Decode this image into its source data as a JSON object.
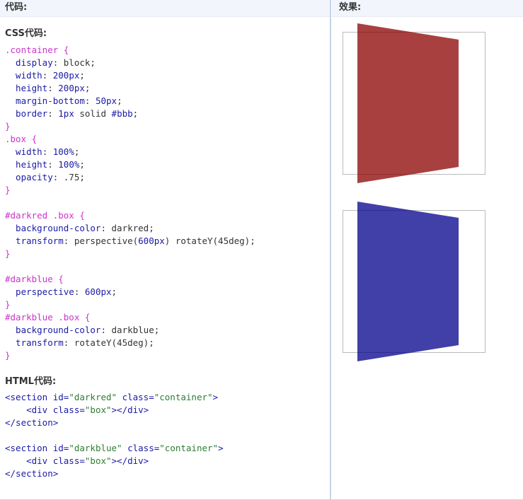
{
  "header": {
    "left_title": "代码:",
    "right_title": "效果:"
  },
  "css_section": {
    "title": "CSS代码:",
    "lines": [
      [
        {
          "t": ".container {",
          "c": "sel"
        }
      ],
      [
        {
          "t": "  display",
          "c": "prop"
        },
        {
          "t": ": block;",
          "c": "val"
        }
      ],
      [
        {
          "t": "  width",
          "c": "prop"
        },
        {
          "t": ": ",
          "c": "val"
        },
        {
          "t": "200px",
          "c": "num"
        },
        {
          "t": ";",
          "c": "val"
        }
      ],
      [
        {
          "t": "  height",
          "c": "prop"
        },
        {
          "t": ": ",
          "c": "val"
        },
        {
          "t": "200px",
          "c": "num"
        },
        {
          "t": ";",
          "c": "val"
        }
      ],
      [
        {
          "t": "  margin-bottom",
          "c": "prop"
        },
        {
          "t": ": ",
          "c": "val"
        },
        {
          "t": "50px",
          "c": "num"
        },
        {
          "t": ";",
          "c": "val"
        }
      ],
      [
        {
          "t": "  border",
          "c": "prop"
        },
        {
          "t": ": ",
          "c": "val"
        },
        {
          "t": "1px",
          "c": "num"
        },
        {
          "t": " solid ",
          "c": "val"
        },
        {
          "t": "#bbb",
          "c": "num"
        },
        {
          "t": ";",
          "c": "val"
        }
      ],
      [
        {
          "t": "}",
          "c": "sel"
        }
      ],
      [
        {
          "t": ".box {",
          "c": "sel"
        }
      ],
      [
        {
          "t": "  width",
          "c": "prop"
        },
        {
          "t": ": ",
          "c": "val"
        },
        {
          "t": "100%",
          "c": "pct"
        },
        {
          "t": ";",
          "c": "val"
        }
      ],
      [
        {
          "t": "  height",
          "c": "prop"
        },
        {
          "t": ": ",
          "c": "val"
        },
        {
          "t": "100%",
          "c": "pct"
        },
        {
          "t": ";",
          "c": "val"
        }
      ],
      [
        {
          "t": "  opacity",
          "c": "prop"
        },
        {
          "t": ": .75;",
          "c": "val"
        }
      ],
      [
        {
          "t": "}",
          "c": "sel"
        }
      ],
      [],
      [
        {
          "t": "#darkred .box {",
          "c": "sel"
        }
      ],
      [
        {
          "t": "  background-color",
          "c": "prop"
        },
        {
          "t": ": darkred;",
          "c": "val"
        }
      ],
      [
        {
          "t": "  transform",
          "c": "prop"
        },
        {
          "t": ": perspective(",
          "c": "val"
        },
        {
          "t": "600px",
          "c": "num"
        },
        {
          "t": ") rotateY(45deg);",
          "c": "val"
        }
      ],
      [
        {
          "t": "}",
          "c": "sel"
        }
      ],
      [],
      [
        {
          "t": "#darkblue {",
          "c": "sel"
        }
      ],
      [
        {
          "t": "  perspective",
          "c": "prop"
        },
        {
          "t": ": ",
          "c": "val"
        },
        {
          "t": "600px",
          "c": "num"
        },
        {
          "t": ";",
          "c": "val"
        }
      ],
      [
        {
          "t": "}",
          "c": "sel"
        }
      ],
      [
        {
          "t": "#darkblue .box {",
          "c": "sel"
        }
      ],
      [
        {
          "t": "  background-color",
          "c": "prop"
        },
        {
          "t": ": darkblue;",
          "c": "val"
        }
      ],
      [
        {
          "t": "  transform",
          "c": "prop"
        },
        {
          "t": ": rotateY(45deg);",
          "c": "val"
        }
      ],
      [
        {
          "t": "}",
          "c": "sel"
        }
      ]
    ]
  },
  "html_section": {
    "title": "HTML代码:",
    "lines": [
      [
        {
          "t": "<section ",
          "c": "tag"
        },
        {
          "t": "id=",
          "c": "attr"
        },
        {
          "t": "\"darkred\"",
          "c": "str"
        },
        {
          "t": " class=",
          "c": "attr"
        },
        {
          "t": "\"container\"",
          "c": "str"
        },
        {
          "t": ">",
          "c": "tag"
        }
      ],
      [
        {
          "t": "    <div ",
          "c": "tag"
        },
        {
          "t": "class=",
          "c": "attr"
        },
        {
          "t": "\"box\"",
          "c": "str"
        },
        {
          "t": "></div>",
          "c": "tag"
        }
      ],
      [
        {
          "t": "</section>",
          "c": "tag"
        }
      ],
      [],
      [
        {
          "t": "<section ",
          "c": "tag"
        },
        {
          "t": "id=",
          "c": "attr"
        },
        {
          "t": "\"darkblue\"",
          "c": "str"
        },
        {
          "t": " class=",
          "c": "attr"
        },
        {
          "t": "\"container\"",
          "c": "str"
        },
        {
          "t": ">",
          "c": "tag"
        }
      ],
      [
        {
          "t": "    <div ",
          "c": "tag"
        },
        {
          "t": "class=",
          "c": "attr"
        },
        {
          "t": "\"box\"",
          "c": "str"
        },
        {
          "t": "></div>",
          "c": "tag"
        }
      ],
      [
        {
          "t": "</section>",
          "c": "tag"
        }
      ]
    ]
  },
  "preview": {
    "boxes": [
      {
        "id": "darkred",
        "color": "#8b0000",
        "opacity": 0.75
      },
      {
        "id": "darkblue",
        "color": "#00008b",
        "opacity": 0.75
      }
    ]
  }
}
